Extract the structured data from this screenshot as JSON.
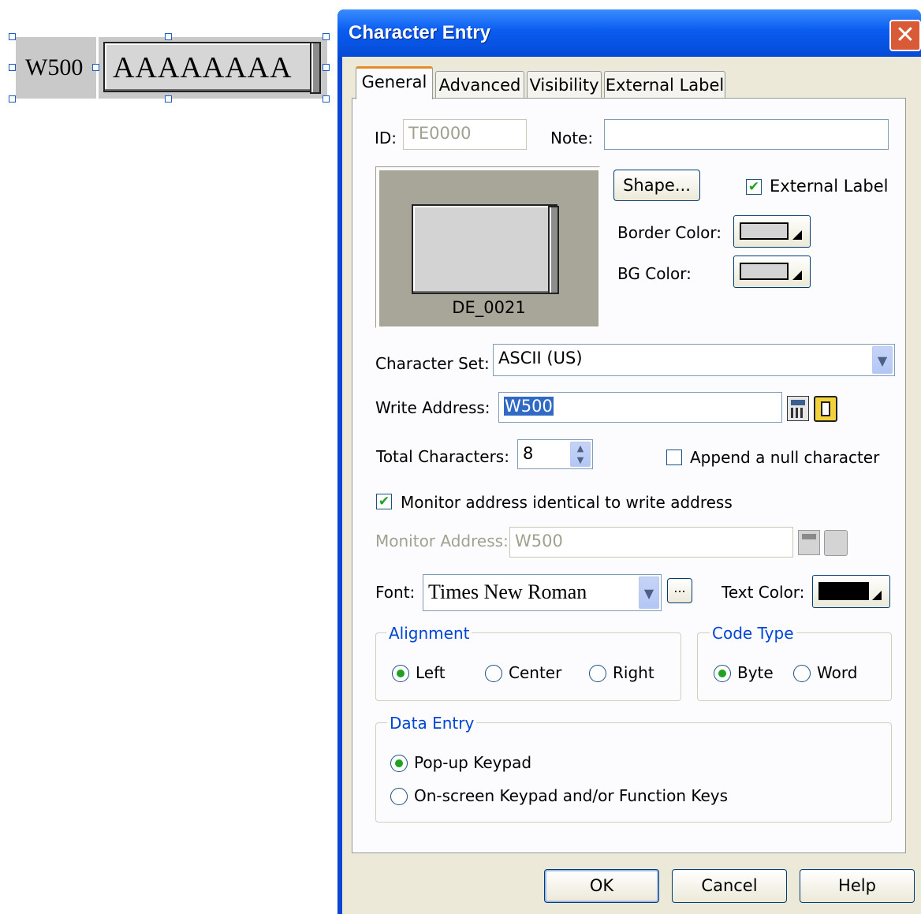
{
  "canvas": {
    "label_text": "W500",
    "entry_text": "AAAAAAAA"
  },
  "dialog": {
    "title": "Character Entry",
    "close_glyph": "✕",
    "tabs": [
      "General",
      "Advanced",
      "Visibility",
      "External Label"
    ],
    "active_tab": "General",
    "id_label": "ID:",
    "id_value": "TE0000",
    "note_label": "Note:",
    "note_value": "",
    "preview_caption": "DE_0021",
    "shape_button": "Shape...",
    "external_label_checkbox": "External Label",
    "external_label_checked": true,
    "border_color_label": "Border Color:",
    "border_color": "#d4d4d4",
    "bg_color_label": "BG Color:",
    "bg_color": "#d4d4d4",
    "character_set_label": "Character Set:",
    "character_set_value": "ASCII (US)",
    "write_address_label": "Write Address:",
    "write_address_value": "W500",
    "total_characters_label": "Total Characters:",
    "total_characters_value": "8",
    "append_null_label": "Append a null character",
    "append_null_checked": false,
    "monitor_identical_label": "Monitor address identical to write address",
    "monitor_identical_checked": true,
    "monitor_address_label": "Monitor Address:",
    "monitor_address_value": "W500",
    "font_label": "Font:",
    "font_value": "Times New Roman",
    "font_more_button": "...",
    "text_color_label": "Text Color:",
    "text_color": "#000000",
    "alignment": {
      "title": "Alignment",
      "options": [
        "Left",
        "Center",
        "Right"
      ],
      "selected": "Left"
    },
    "code_type": {
      "title": "Code Type",
      "options": [
        "Byte",
        "Word"
      ],
      "selected": "Byte"
    },
    "data_entry": {
      "title": "Data Entry",
      "options": [
        "Pop-up Keypad",
        "On-screen Keypad and/or Function Keys"
      ],
      "selected": "Pop-up Keypad"
    },
    "buttons": {
      "ok": "OK",
      "cancel": "Cancel",
      "help": "Help"
    },
    "accent_color": "#0046d5"
  }
}
